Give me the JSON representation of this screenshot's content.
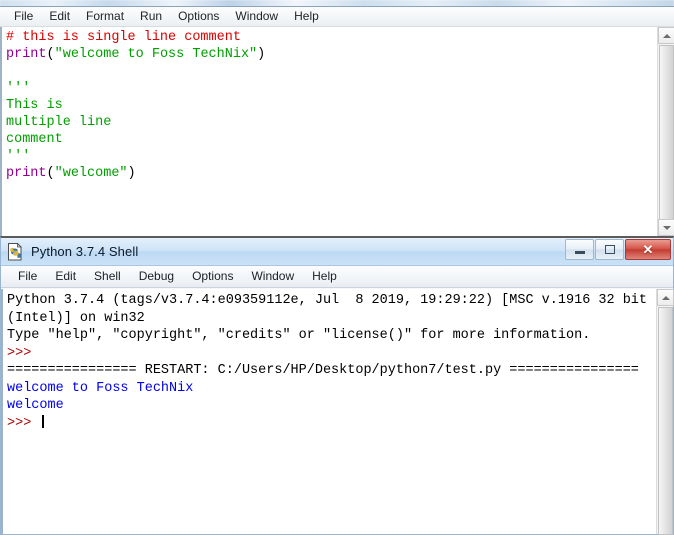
{
  "editor": {
    "menu": [
      {
        "label": "File"
      },
      {
        "label": "Edit"
      },
      {
        "label": "Format"
      },
      {
        "label": "Run"
      },
      {
        "label": "Options"
      },
      {
        "label": "Window"
      },
      {
        "label": "Help"
      }
    ],
    "code_lines": [
      {
        "id": "l1",
        "segments": [
          {
            "text": "# this is single line comment",
            "cls": "tok-comment"
          }
        ]
      },
      {
        "id": "l2",
        "segments": [
          {
            "text": "print",
            "cls": "tok-kw"
          },
          {
            "text": "(",
            "cls": "tok-plain"
          },
          {
            "text": "\"welcome to Foss TechNix\"",
            "cls": "tok-string"
          },
          {
            "text": ")",
            "cls": "tok-plain"
          }
        ]
      },
      {
        "id": "l3",
        "segments": [
          {
            "text": "",
            "cls": "tok-plain"
          }
        ]
      },
      {
        "id": "l4",
        "segments": [
          {
            "text": "'''",
            "cls": "tok-string"
          }
        ]
      },
      {
        "id": "l5",
        "segments": [
          {
            "text": "This is",
            "cls": "tok-string"
          }
        ]
      },
      {
        "id": "l6",
        "segments": [
          {
            "text": "multiple line",
            "cls": "tok-string"
          }
        ]
      },
      {
        "id": "l7",
        "segments": [
          {
            "text": "comment",
            "cls": "tok-string"
          }
        ]
      },
      {
        "id": "l8",
        "segments": [
          {
            "text": "'''",
            "cls": "tok-string"
          }
        ]
      },
      {
        "id": "l9",
        "segments": [
          {
            "text": "print",
            "cls": "tok-kw"
          },
          {
            "text": "(",
            "cls": "tok-plain"
          },
          {
            "text": "\"welcome\"",
            "cls": "tok-string"
          },
          {
            "text": ")",
            "cls": "tok-plain"
          }
        ]
      }
    ],
    "scrollbar": {
      "up_icon": "arrow-up-icon",
      "down_icon": "arrow-down-icon"
    }
  },
  "shell": {
    "title": "Python 3.7.4 Shell",
    "icon": "python-file-icon",
    "window_buttons": [
      {
        "name": "minimize",
        "glyph": "minimize-icon",
        "label": ""
      },
      {
        "name": "maximize",
        "glyph": "maximize-icon",
        "label": ""
      },
      {
        "name": "close",
        "glyph": "close-icon",
        "label": "✕"
      }
    ],
    "menu": [
      {
        "label": "File"
      },
      {
        "label": "Edit"
      },
      {
        "label": "Shell"
      },
      {
        "label": "Debug"
      },
      {
        "label": "Options"
      },
      {
        "label": "Window"
      },
      {
        "label": "Help"
      }
    ],
    "output_lines": [
      {
        "id": "s1",
        "segments": [
          {
            "text": "Python 3.7.4 (tags/v3.7.4:e09359112e, Jul  8 2019, 19:29:22) [MSC v.1916 32 bit",
            "cls": "sh-black"
          }
        ]
      },
      {
        "id": "s2",
        "segments": [
          {
            "text": "(Intel)] on win32",
            "cls": "sh-black"
          }
        ]
      },
      {
        "id": "s3",
        "segments": [
          {
            "text": "Type \"help\", \"copyright\", \"credits\" or \"license()\" for more information.",
            "cls": "sh-black"
          }
        ]
      },
      {
        "id": "s4",
        "segments": [
          {
            "text": ">>>",
            "cls": "sh-prompt"
          }
        ]
      },
      {
        "id": "s5",
        "segments": [
          {
            "text": "================ RESTART: C:/Users/HP/Desktop/python7/test.py ================",
            "cls": "sh-black"
          }
        ]
      },
      {
        "id": "s6",
        "segments": [
          {
            "text": "welcome to Foss TechNix",
            "cls": "sh-blue"
          }
        ]
      },
      {
        "id": "s7",
        "segments": [
          {
            "text": "welcome",
            "cls": "sh-blue"
          }
        ]
      },
      {
        "id": "s8",
        "segments": [
          {
            "text": ">>> ",
            "cls": "sh-prompt"
          }
        ],
        "caret": true
      }
    ],
    "scrollbar": {
      "up_icon": "arrow-up-icon",
      "down_icon": "arrow-down-icon"
    }
  },
  "colors": {
    "comment": "#dd0000",
    "keyword": "#900090",
    "string": "#00a000",
    "output": "#0000ee",
    "prompt": "#aa0000",
    "titlebar": "#cfe4f7",
    "close_button": "#c33d32"
  }
}
